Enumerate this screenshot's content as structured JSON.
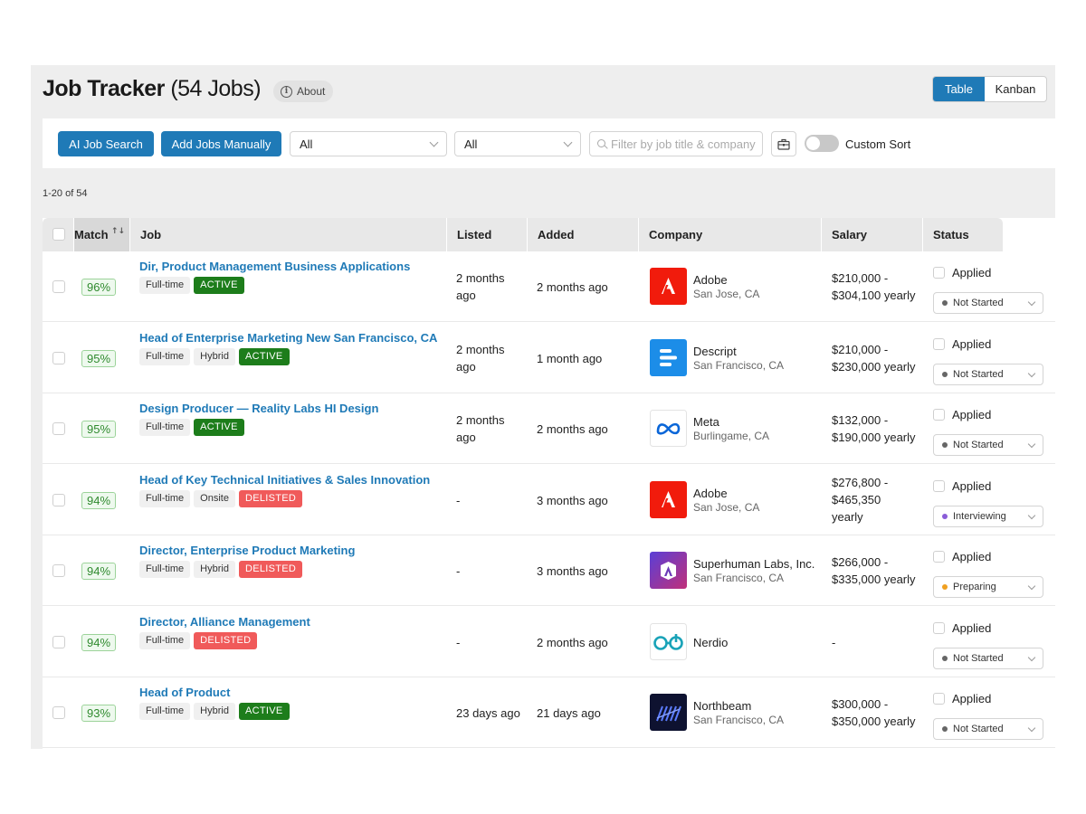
{
  "header": {
    "title": "Job Tracker",
    "count": "(54 Jobs)",
    "about_label": "About",
    "views": [
      "Table",
      "Kanban"
    ],
    "active_view": "Table"
  },
  "toolbar": {
    "ai_search_label": "AI Job Search",
    "add_manual_label": "Add Jobs Manually",
    "filter1_value": "All",
    "filter2_value": "All",
    "search_placeholder": "Filter by job title & company",
    "custom_sort_label": "Custom Sort",
    "custom_sort_on": false
  },
  "pagination": {
    "range": "1-20 of 54"
  },
  "columns": [
    "Match",
    "Job",
    "Listed",
    "Added",
    "Company",
    "Salary",
    "Status"
  ],
  "colors": {
    "primary": "#1f7ab7",
    "active_tag": "#1d7d1b",
    "delisted_tag": "#f05a5a",
    "match_green": "#2f8a2e"
  },
  "rows": [
    {
      "match": "96%",
      "title": "Dir, Product Management Business Applications",
      "tags": [
        {
          "text": "Full-time",
          "kind": "plain"
        },
        {
          "text": "ACTIVE",
          "kind": "active"
        }
      ],
      "listed": [
        "2 months",
        "ago"
      ],
      "added": "2 months ago",
      "company": "Adobe",
      "location": "San Jose, CA",
      "logo": "adobe-logo",
      "salary": [
        "$210,000 -",
        "$304,100 yearly"
      ],
      "applied_label": "Applied",
      "status": "Not Started",
      "status_color": "#666666"
    },
    {
      "match": "95%",
      "title": "Head of Enterprise Marketing New San Francisco, CA",
      "tags": [
        {
          "text": "Full-time",
          "kind": "plain"
        },
        {
          "text": "Hybrid",
          "kind": "plain"
        },
        {
          "text": "ACTIVE",
          "kind": "active"
        }
      ],
      "listed": [
        "2 months",
        "ago"
      ],
      "added": "1 month ago",
      "company": "Descript",
      "location": "San Francisco, CA",
      "logo": "descript-logo",
      "salary": [
        "$210,000 -",
        "$230,000 yearly"
      ],
      "applied_label": "Applied",
      "status": "Not Started",
      "status_color": "#666666"
    },
    {
      "match": "95%",
      "title": "Design Producer — Reality Labs HI Design",
      "tags": [
        {
          "text": "Full-time",
          "kind": "plain"
        },
        {
          "text": "ACTIVE",
          "kind": "active"
        }
      ],
      "listed": [
        "2 months",
        "ago"
      ],
      "added": "2 months ago",
      "company": "Meta",
      "location": "Burlingame, CA",
      "logo": "meta-logo",
      "salary": [
        "$132,000 -",
        "$190,000 yearly"
      ],
      "applied_label": "Applied",
      "status": "Not Started",
      "status_color": "#666666"
    },
    {
      "match": "94%",
      "title": "Head of Key Technical Initiatives & Sales Innovation",
      "tags": [
        {
          "text": "Full-time",
          "kind": "plain"
        },
        {
          "text": "Onsite",
          "kind": "plain"
        },
        {
          "text": "DELISTED",
          "kind": "delisted"
        }
      ],
      "listed": [
        "-"
      ],
      "added": "3 months ago",
      "company": "Adobe",
      "location": "San Jose, CA",
      "logo": "adobe-logo",
      "salary": [
        "$276,800 -",
        "$465,350",
        "yearly"
      ],
      "applied_label": "Applied",
      "status": "Interviewing",
      "status_color": "#8a5cd8"
    },
    {
      "match": "94%",
      "title": "Director, Enterprise Product Marketing",
      "tags": [
        {
          "text": "Full-time",
          "kind": "plain"
        },
        {
          "text": "Hybrid",
          "kind": "plain"
        },
        {
          "text": "DELISTED",
          "kind": "delisted"
        }
      ],
      "listed": [
        "-"
      ],
      "added": "3 months ago",
      "company": "Superhuman Labs, Inc.",
      "location": "San Francisco, CA",
      "logo": "superhuman-logo",
      "salary": [
        "$266,000 -",
        "$335,000 yearly"
      ],
      "applied_label": "Applied",
      "status": "Preparing",
      "status_color": "#f0a020"
    },
    {
      "match": "94%",
      "title": "Director, Alliance Management",
      "tags": [
        {
          "text": "Full-time",
          "kind": "plain"
        },
        {
          "text": "DELISTED",
          "kind": "delisted"
        }
      ],
      "listed": [
        "-"
      ],
      "added": "2 months ago",
      "company": "Nerdio",
      "location": "",
      "logo": "nerdio-logo",
      "salary": [
        "-"
      ],
      "applied_label": "Applied",
      "status": "Not Started",
      "status_color": "#666666"
    },
    {
      "match": "93%",
      "title": "Head of Product",
      "tags": [
        {
          "text": "Full-time",
          "kind": "plain"
        },
        {
          "text": "Hybrid",
          "kind": "plain"
        },
        {
          "text": "ACTIVE",
          "kind": "active"
        }
      ],
      "listed": [
        "23 days ago"
      ],
      "added": "21 days ago",
      "company": "Northbeam",
      "location": "San Francisco, CA",
      "logo": "northbeam-logo",
      "salary": [
        "$300,000 -",
        "$350,000 yearly"
      ],
      "applied_label": "Applied",
      "status": "Not Started",
      "status_color": "#666666"
    }
  ]
}
